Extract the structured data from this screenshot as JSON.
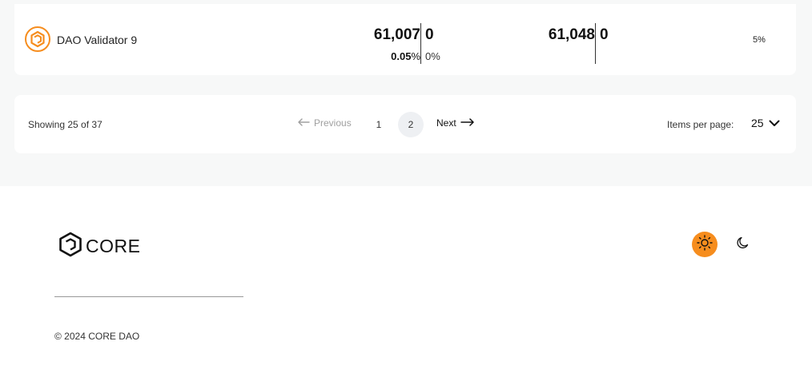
{
  "validator": {
    "name": "DAO Validator 9",
    "staked_core": "61,007",
    "staked_core_right": "0",
    "staked_pct": "0.05",
    "pct_sign": "%",
    "staked_pct_right": "0%",
    "power": "61,048",
    "power_right": "0",
    "commission": "5%"
  },
  "pagination": {
    "showing": "Showing 25 of 37",
    "previous_label": "Previous",
    "pages": [
      "1",
      "2"
    ],
    "current_page": "2",
    "next_label": "Next",
    "items_per_page_label": "Items per page:",
    "items_per_page_value": "25"
  },
  "footer": {
    "logo_text": "CORE",
    "copyright": "© 2024 CORE DAO"
  },
  "colors": {
    "accent": "#f68d1e",
    "background": "#f7f8f8",
    "card": "#ffffff"
  },
  "icons": {
    "validator": "core-hexagon-icon",
    "previous": "arrow-left-icon",
    "next": "arrow-right-icon",
    "dropdown": "chevron-down-icon",
    "light_theme": "sun-icon",
    "dark_theme": "moon-icon"
  }
}
